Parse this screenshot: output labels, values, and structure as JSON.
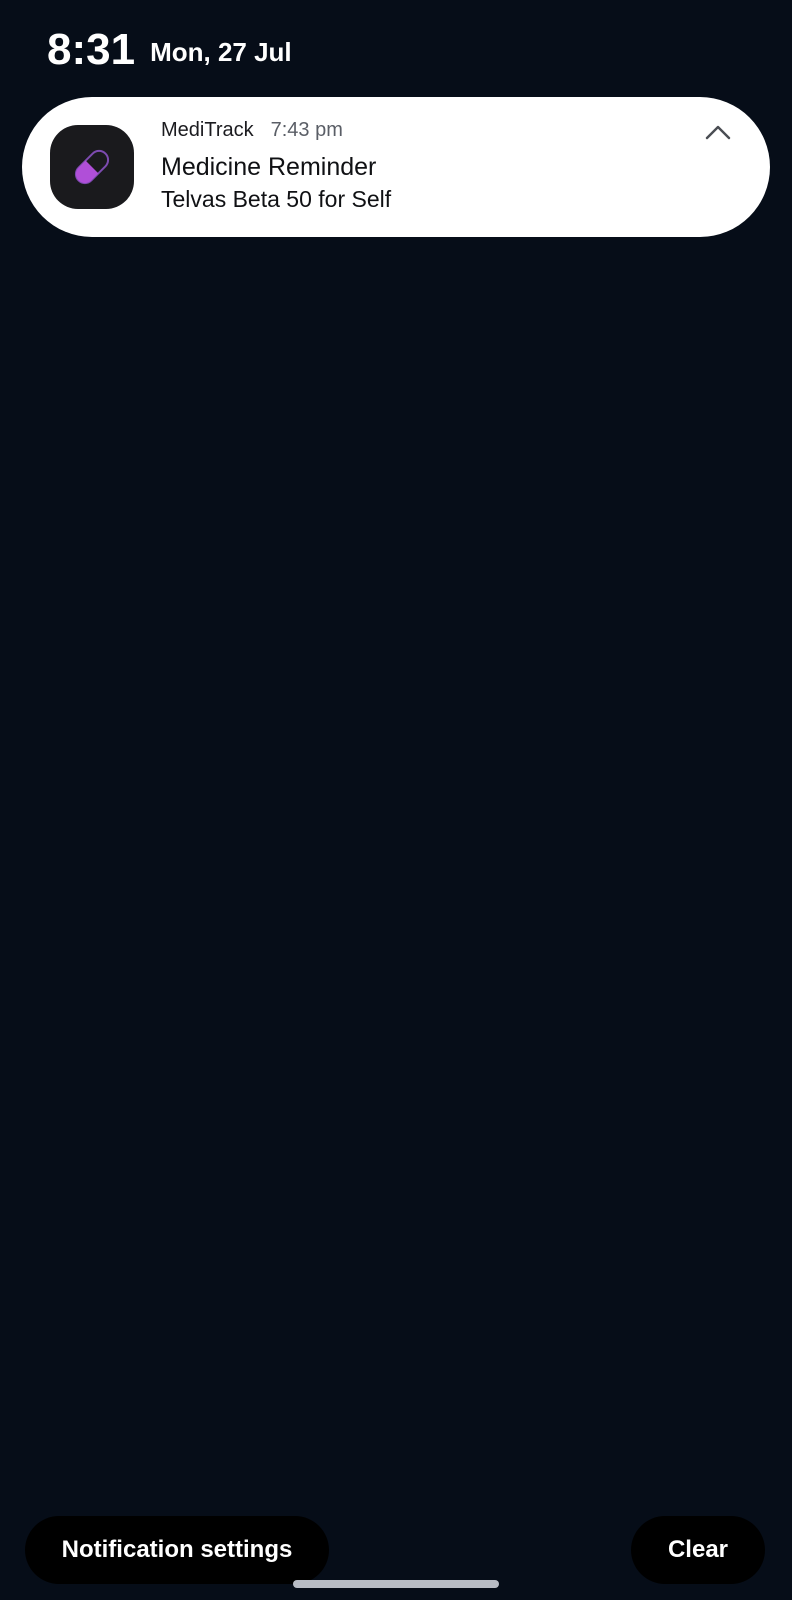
{
  "status": {
    "time": "8:31",
    "date": "Mon, 27 Jul"
  },
  "notification": {
    "app_name": "MediTrack",
    "time": "7:43 pm",
    "title": "Medicine Reminder",
    "body": "Telvas Beta 50 for Self",
    "icon": "pill-icon",
    "icon_color": "#9b3fcf",
    "collapse_icon": "chevron-up-icon"
  },
  "actions": {
    "settings_label": "Notification settings",
    "clear_label": "Clear"
  },
  "colors": {
    "background": "#060d18",
    "card": "#ffffff",
    "button": "#000000"
  }
}
